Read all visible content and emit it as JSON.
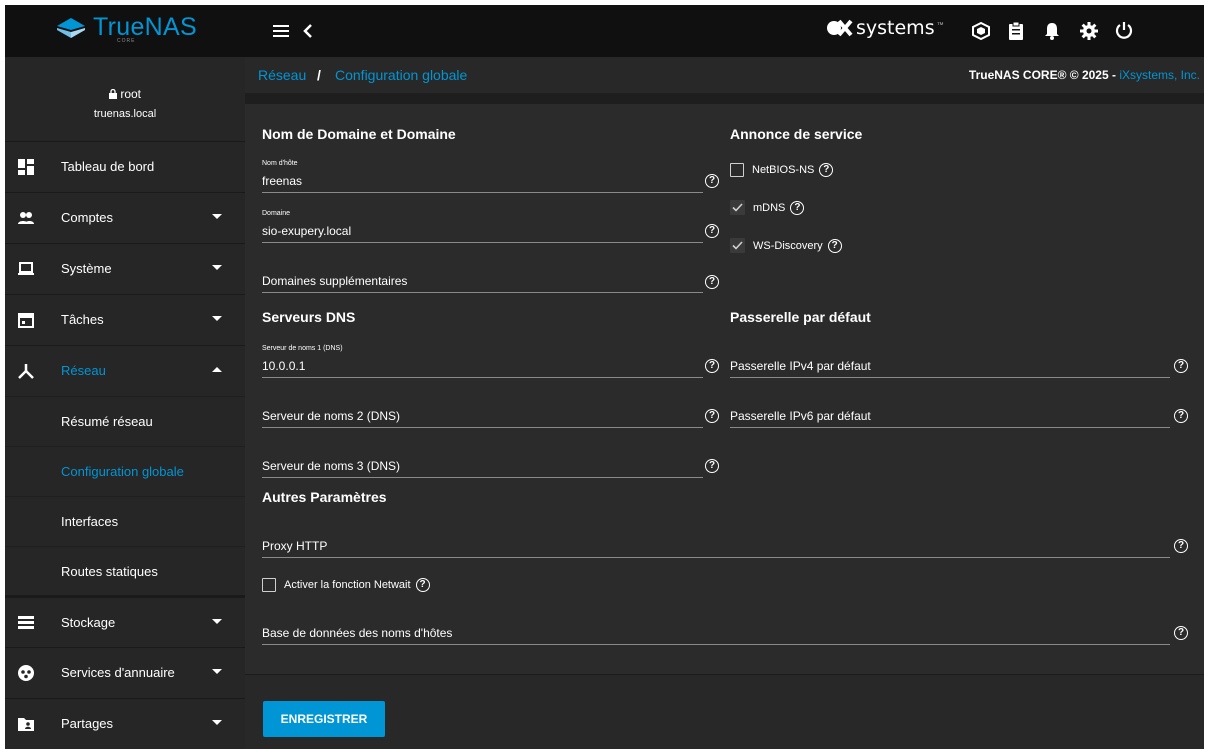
{
  "brand": {
    "name": "TrueNAS",
    "sub": "CORE",
    "vendor": "systems",
    "vendor_tm": "™"
  },
  "colors": {
    "accent": "#0095d5",
    "background": "#1e1e1e",
    "sidebar": "#262626",
    "topbar": "#101010"
  },
  "user": {
    "name": "root",
    "host": "truenas.local"
  },
  "sidebar": {
    "items": [
      {
        "label": "Tableau de bord",
        "icon": "dashboard-icon"
      },
      {
        "label": "Comptes",
        "icon": "people-icon"
      },
      {
        "label": "Système",
        "icon": "laptop-icon"
      },
      {
        "label": "Tâches",
        "icon": "calendar-icon"
      },
      {
        "label": "Réseau",
        "icon": "network-icon"
      },
      {
        "label": "Stockage",
        "icon": "storage-icon"
      },
      {
        "label": "Services d'annuaire",
        "icon": "directory-icon"
      },
      {
        "label": "Partages",
        "icon": "folder-share-icon"
      }
    ],
    "sub_items": [
      {
        "label": "Résumé réseau"
      },
      {
        "label": "Configuration globale"
      },
      {
        "label": "Interfaces"
      },
      {
        "label": "Routes statiques"
      }
    ]
  },
  "breadcrumb": {
    "parent": "Réseau",
    "separator": "/",
    "current": "Configuration globale"
  },
  "copyright": {
    "text": "TrueNAS CORE® © 2025 - ",
    "link": "iXsystems, Inc."
  },
  "form": {
    "domain_section": {
      "title": "Nom de Domaine et Domaine",
      "hostname_label": "Nom d'hôte",
      "hostname_value": "freenas",
      "domain_label": "Domaine",
      "domain_value": "sio-exupery.local",
      "additional_domains": "Domaines supplémentaires"
    },
    "service_section": {
      "title": "Annonce de service",
      "netbios": {
        "label": "NetBIOS-NS",
        "checked": false
      },
      "mdns": {
        "label": "mDNS",
        "checked": true
      },
      "wsd": {
        "label": "WS-Discovery",
        "checked": true
      }
    },
    "dns_section": {
      "title": "Serveurs DNS",
      "ns1_label": "Serveur de noms 1 (DNS)",
      "ns1_value": "10.0.0.1",
      "ns2_placeholder": "Serveur de noms 2 (DNS)",
      "ns3_placeholder": "Serveur de noms 3 (DNS)"
    },
    "gateway_section": {
      "title": "Passerelle par défaut",
      "ipv4_placeholder": "Passerelle IPv4 par défaut",
      "ipv6_placeholder": "Passerelle IPv6 par défaut"
    },
    "other_section": {
      "title": "Autres Paramètres",
      "proxy_placeholder": "Proxy HTTP",
      "netwait": {
        "label": "Activer la fonction Netwait",
        "checked": false
      },
      "hosts_db_placeholder": "Base de données des noms d'hôtes"
    },
    "save_label": "ENREGISTRER"
  }
}
